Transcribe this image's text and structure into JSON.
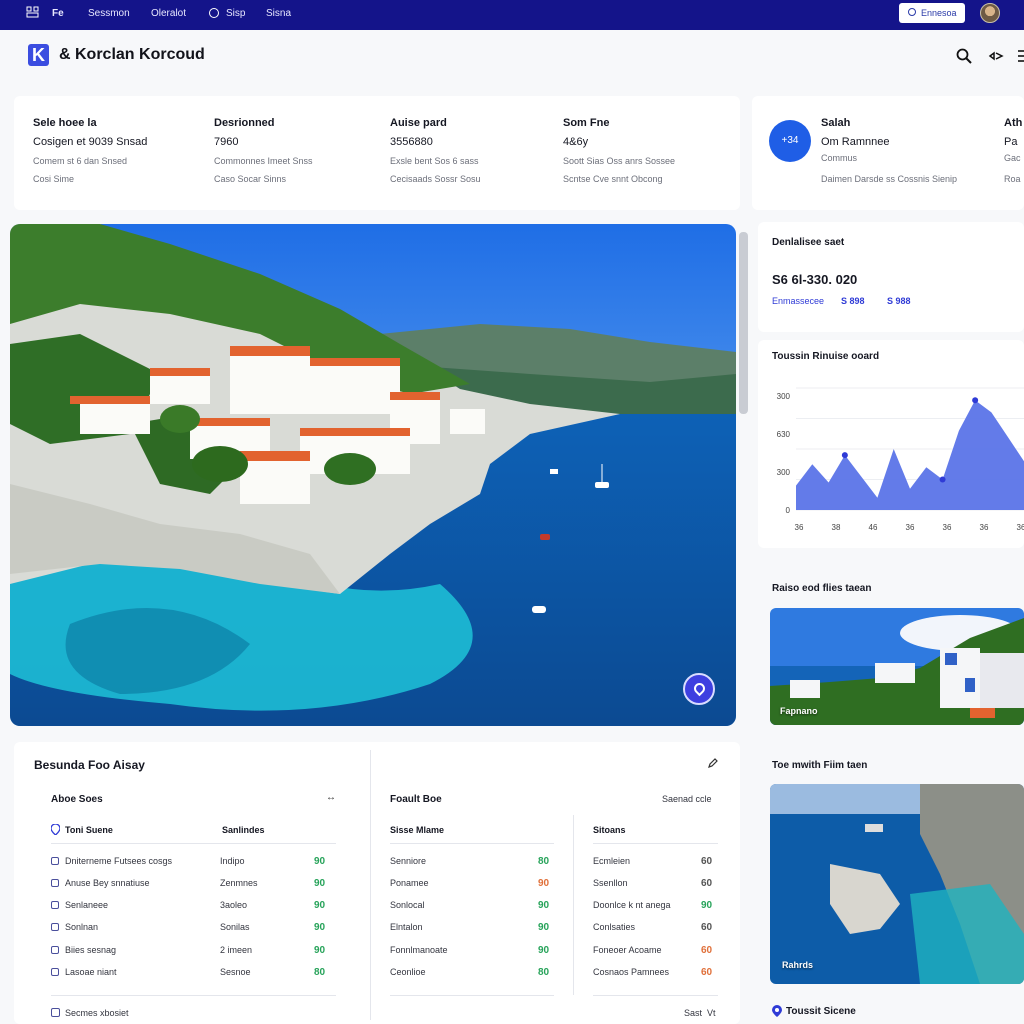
{
  "topbar": {
    "items": [
      "Fe",
      "Sessmon",
      "Oleralot",
      "Sisp",
      "Sisna"
    ],
    "button_label": "Ennesoa"
  },
  "header": {
    "brand": "& Korclan Korcoud"
  },
  "stats": [
    {
      "label": "Sele hoee la",
      "value": "Cosigen et 9039 Snsad",
      "sub1": "Comem st 6 dan Snsed",
      "sub2": "Cosi Sime"
    },
    {
      "label": "Desrionned",
      "value": "7960",
      "sub1": "Commonnes Imeet Snss",
      "sub2": "Caso Socar Sinns"
    },
    {
      "label": "Auise pard",
      "value": "3556880",
      "sub1": "Exsle bent Sos 6 sass",
      "sub2": "Cecisaads Sossr Sosu"
    },
    {
      "label": "Som Fne",
      "value": "4&6y",
      "sub1": "Soott Sias Oss anrs Sossee",
      "sub2": "Scntse Cve snnt Obcong"
    }
  ],
  "profile": {
    "avatar_text": "+34",
    "name": "Salah",
    "role": "Om Ramnnee",
    "sub": "Commus",
    "desc": "Daimen Darsde ss Cossnis Sienip",
    "extra_label": "Ath",
    "extra_value": "Pa",
    "extra_sub1": "Gac",
    "extra_sub2": "Roa"
  },
  "side": {
    "card1_title": "Denlalisee saet",
    "card1_value": "S6 6l-330. 020",
    "card1_sub": "Enmassecee",
    "card1_v1": "S 898",
    "card1_v2": "S 988",
    "chart_title": "Toussin Rinuise ooard",
    "thumb1_title": "Raiso eod flies taean",
    "thumb1_caption": "Fapnano",
    "thumb2_title": "Toe mwith Fiim taen",
    "thumb2_caption": "Rahrds",
    "bottom_label": "Toussit Sicene"
  },
  "chart_data": {
    "type": "area",
    "x": [
      "36",
      "38",
      "46",
      "36",
      "36",
      "36",
      "36"
    ],
    "y_ticks": [
      "0",
      "300",
      "630",
      "300",
      "600"
    ],
    "values": [
      40,
      75,
      45,
      90,
      55,
      20,
      100,
      35,
      70,
      50,
      130,
      180,
      160,
      120,
      80
    ],
    "ylim": [
      0,
      200
    ]
  },
  "bottom": {
    "section_title": "Besunda Foo Aisay",
    "col1_title": "Aboe Soes",
    "col1_h1": "Toni Suene",
    "col1_h2": "Sanlindes",
    "col2_title": "Foault Boe",
    "col2_h1": "Sisse Mlame",
    "col3_title": "Saenad ccle",
    "col3_h1": "Sitoans",
    "rows_a": [
      {
        "name": "Dniterneme Futsees cosgs",
        "col": "Indipo",
        "val": "90"
      },
      {
        "name": "Anuse Bey snnatiuse",
        "col": "Zenmnes",
        "val": "90"
      },
      {
        "name": "Senlaneee",
        "col": "3aoleo",
        "val": "90"
      },
      {
        "name": "Sonlnan",
        "col": "Sonilas",
        "val": "90"
      },
      {
        "name": "Biies sesnag",
        "col": "2 imeen",
        "val": "90"
      },
      {
        "name": "Lasoae niant",
        "col": "Sesnoe",
        "val": "80"
      }
    ],
    "rows_b": [
      {
        "name": "Senniore",
        "val": "80",
        "tone": "g"
      },
      {
        "name": "Ponamee",
        "val": "90",
        "tone": "o"
      },
      {
        "name": "Sonlocal",
        "val": "90",
        "tone": "g"
      },
      {
        "name": "Elntalon",
        "val": "90",
        "tone": "g"
      },
      {
        "name": "Fonnlmanoate",
        "val": "90",
        "tone": "g"
      },
      {
        "name": "Ceonlioe",
        "val": "80",
        "tone": "g"
      }
    ],
    "rows_c": [
      {
        "name": "Ecmleien",
        "val": "60",
        "tone": "n"
      },
      {
        "name": "Ssenllon",
        "val": "60",
        "tone": "n"
      },
      {
        "name": "Doonlce k nt anega",
        "val": "90",
        "tone": "g"
      },
      {
        "name": "Conlsaties",
        "val": "60",
        "tone": "n"
      },
      {
        "name": "Foneoer Acoame",
        "val": "60",
        "tone": "o"
      },
      {
        "name": "Cosnaos Pamnees",
        "val": "60",
        "tone": "o"
      }
    ],
    "footer_label": "Secmes xbosiet",
    "footer_right1": "Sast",
    "footer_right2": "Vt"
  },
  "colors": {
    "topbar": "#14148a",
    "accent": "#3b4de0",
    "positive": "#27a35a",
    "warning": "#e0703a"
  }
}
